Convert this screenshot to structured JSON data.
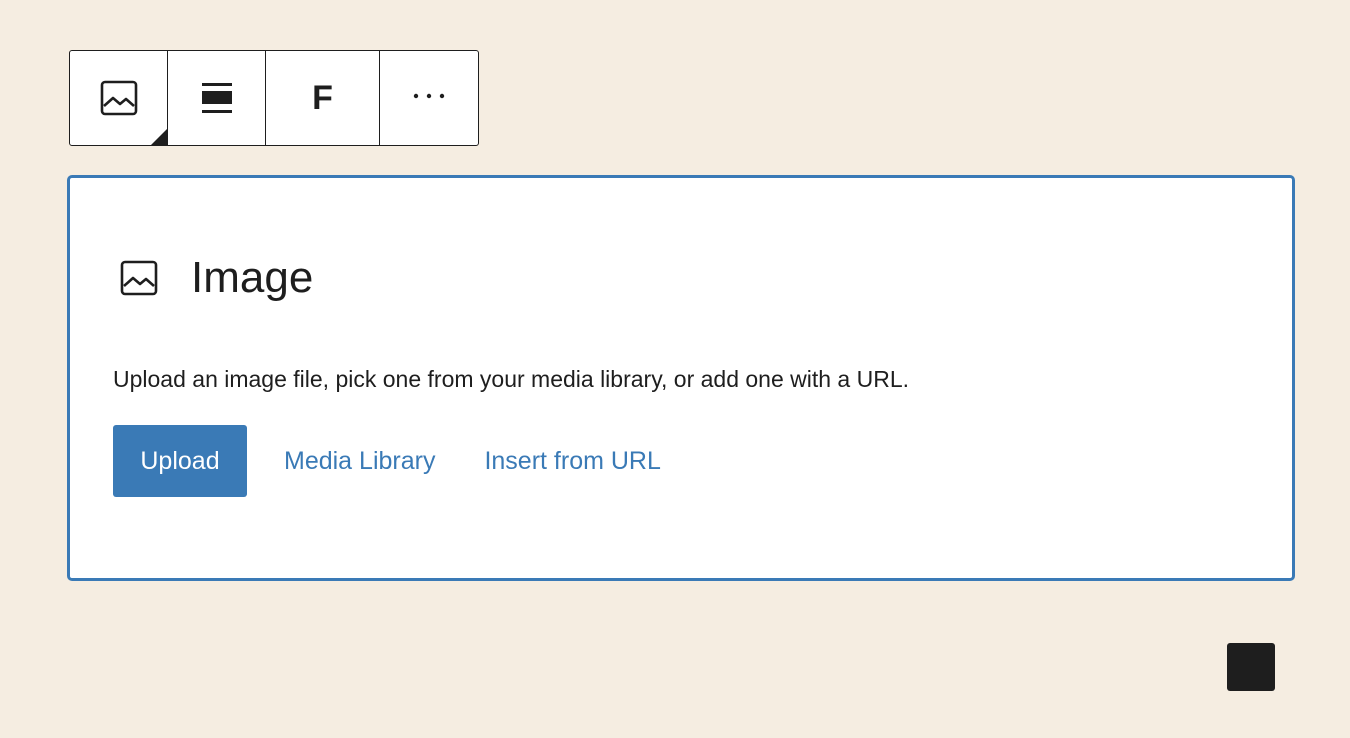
{
  "toolbar": {
    "buttons": [
      {
        "name": "image-block-switcher",
        "icon": "image-icon"
      },
      {
        "name": "align-wide",
        "icon": "align-wide-icon"
      },
      {
        "name": "font-f",
        "icon": "f-icon",
        "label": "F"
      },
      {
        "name": "more-options",
        "icon": "more-horizontal-icon",
        "label": "⋯"
      }
    ]
  },
  "placeholder": {
    "icon": "image-icon",
    "title": "Image",
    "instructions": "Upload an image file, pick one from your media library, or add one with a URL.",
    "upload_label": "Upload",
    "media_library_label": "Media Library",
    "insert_url_label": "Insert from URL"
  },
  "colors": {
    "background": "#f5ede1",
    "accent": "#3a7ab6",
    "dark": "#1e1e1e",
    "surface": "#ffffff"
  }
}
